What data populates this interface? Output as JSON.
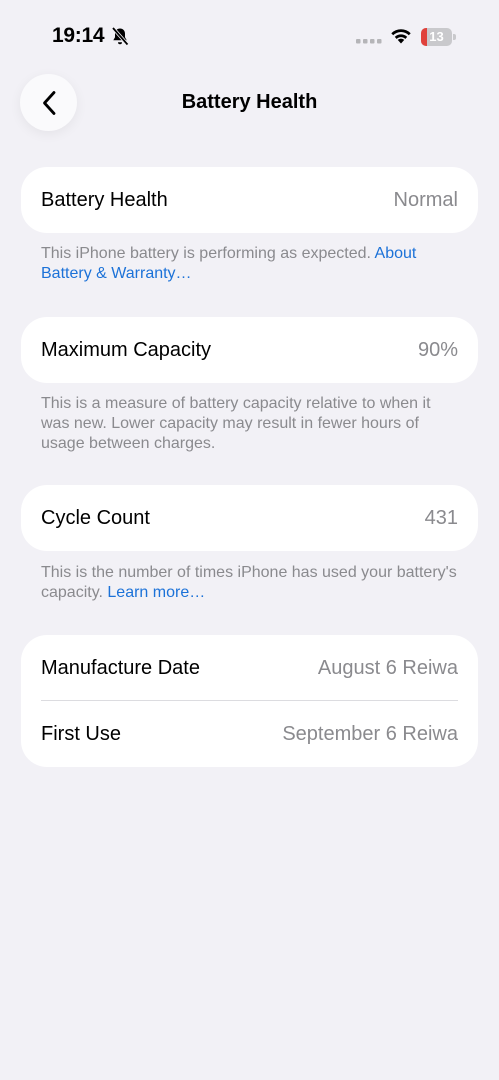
{
  "status": {
    "time": "19:14",
    "battery_level": "13",
    "battery_fraction": 0.13
  },
  "nav": {
    "title": "Battery Health",
    "back_icon": "chevron-left-icon"
  },
  "battery_health": {
    "label": "Battery Health",
    "value": "Normal",
    "footnote": "This iPhone battery is performing as expected. ",
    "footnote_link": "About Battery & Warranty…"
  },
  "maximum_capacity": {
    "label": "Maximum Capacity",
    "value": "90%",
    "footnote": "This is a measure of battery capacity relative to when it was new. Lower capacity may result in fewer hours of usage between charges."
  },
  "cycle_count": {
    "label": "Cycle Count",
    "value": "431",
    "footnote": "This is the number of times iPhone has used your battery's capacity. ",
    "footnote_link": "Learn more…"
  },
  "dates": {
    "manufacture_label": "Manufacture Date",
    "manufacture_value": "August 6 Reiwa",
    "first_use_label": "First Use",
    "first_use_value": "September 6 Reiwa"
  },
  "colors": {
    "background": "#f2f1f6",
    "link": "#1c72d8",
    "battery_low": "#e0413b"
  }
}
